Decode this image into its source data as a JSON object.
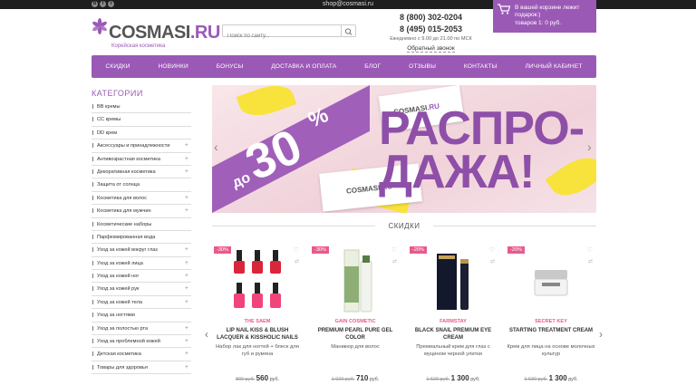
{
  "topbar": {
    "email": "shop@cosmasi.ru",
    "social": [
      "vk-icon",
      "fb-icon",
      "tw-icon"
    ]
  },
  "logo": {
    "name_main": "COSMASI",
    "name_tld": ".RU",
    "subtitle": "Корейская косметика"
  },
  "search": {
    "placeholder": "Поиск по сайту..."
  },
  "contacts": {
    "phone1": "8 (800) 302-0204",
    "phone2": "8 (495) 015-2053",
    "hours": "Ежедневно с 9.00 до 21.00 по МСК",
    "callback": "Обратный звонок"
  },
  "cart": {
    "line1": "В вашей корзине лежит",
    "line2": "подарок:)",
    "line3": "товаров 1: 0 руб."
  },
  "nav": [
    "СКИДКИ",
    "НОВИНКИ",
    "БОНУСЫ",
    "ДОСТАВКА И ОПЛАТА",
    "БЛОГ",
    "ОТЗЫВЫ",
    "КОНТАКТЫ",
    "ЛИЧНЫЙ КАБИНЕТ"
  ],
  "categories": {
    "title": "КАТЕГОРИИ",
    "items": [
      {
        "label": "BB кремы",
        "plus": ""
      },
      {
        "label": "CC кремы",
        "plus": ""
      },
      {
        "label": "DD крем",
        "plus": ""
      },
      {
        "label": "Аксессуары и принадлежности",
        "plus": "+"
      },
      {
        "label": "Антивозрастная косметика",
        "plus": "+"
      },
      {
        "label": "Декоративная косметика",
        "plus": "+"
      },
      {
        "label": "Защита от солнца",
        "plus": ""
      },
      {
        "label": "Косметика для волос",
        "plus": "+"
      },
      {
        "label": "Косметика для мужчин",
        "plus": "+"
      },
      {
        "label": "Косметические наборы",
        "plus": ""
      },
      {
        "label": "Парфюмированная вода",
        "plus": ""
      },
      {
        "label": "Уход за кожей вокруг глаз",
        "plus": "+"
      },
      {
        "label": "Уход за кожей лица",
        "plus": "+"
      },
      {
        "label": "Уход за кожей ног",
        "plus": "+"
      },
      {
        "label": "Уход за кожей рук",
        "plus": "+"
      },
      {
        "label": "Уход за кожей тела",
        "plus": "+"
      },
      {
        "label": "Уход за ногтями",
        "plus": ""
      },
      {
        "label": "Уход за полостью рта",
        "plus": "+"
      },
      {
        "label": "Уход за проблемной кожей",
        "plus": "+"
      },
      {
        "label": "Детская косметика",
        "plus": "+"
      },
      {
        "label": "Товары для здоровья",
        "plus": "+"
      }
    ]
  },
  "banner": {
    "do": "до",
    "num": "30",
    "pct": "%",
    "line1": "РАСПРО-",
    "line2": "ДАЖА!",
    "box_brand": "COSMASI",
    "box_tld": ".RU",
    "prev": "‹",
    "next": "›"
  },
  "section": {
    "title": "СКИДКИ"
  },
  "products": [
    {
      "badge": "-30%",
      "brand": "THE SAEM",
      "name": "LIP NAIL KISS & BLUSH LACQUER & KISSHOLIC NAILS",
      "desc": "Набор лак для ногтей + блеск для губ и румяна",
      "old_price": "800 руб.",
      "new_price": "560",
      "currency": "руб."
    },
    {
      "badge": "-30%",
      "brand": "GAIN COSMETIC",
      "name": "PREMIUM PEARL PURE GEL COLOR",
      "desc": "Маникюр для волос",
      "old_price": "1 020 руб.",
      "new_price": "710",
      "currency": "руб."
    },
    {
      "badge": "-20%",
      "brand": "FARMSTAY",
      "name": "BLACK SNAIL PREMIUM EYE CREAM",
      "desc": "Премиальный крем для глаз с муцином черной улитки",
      "old_price": "1 620 руб.",
      "new_price": "1 300",
      "currency": "руб."
    },
    {
      "badge": "-20%",
      "brand": "SECRET KEY",
      "name": "STARTING TREATMENT CREAM",
      "desc": "Крем для лица на основе молочных культур",
      "old_price": "1 630 руб.",
      "new_price": "1 300",
      "currency": "руб."
    }
  ],
  "product_nav": {
    "prev": "‹",
    "next": "›"
  }
}
